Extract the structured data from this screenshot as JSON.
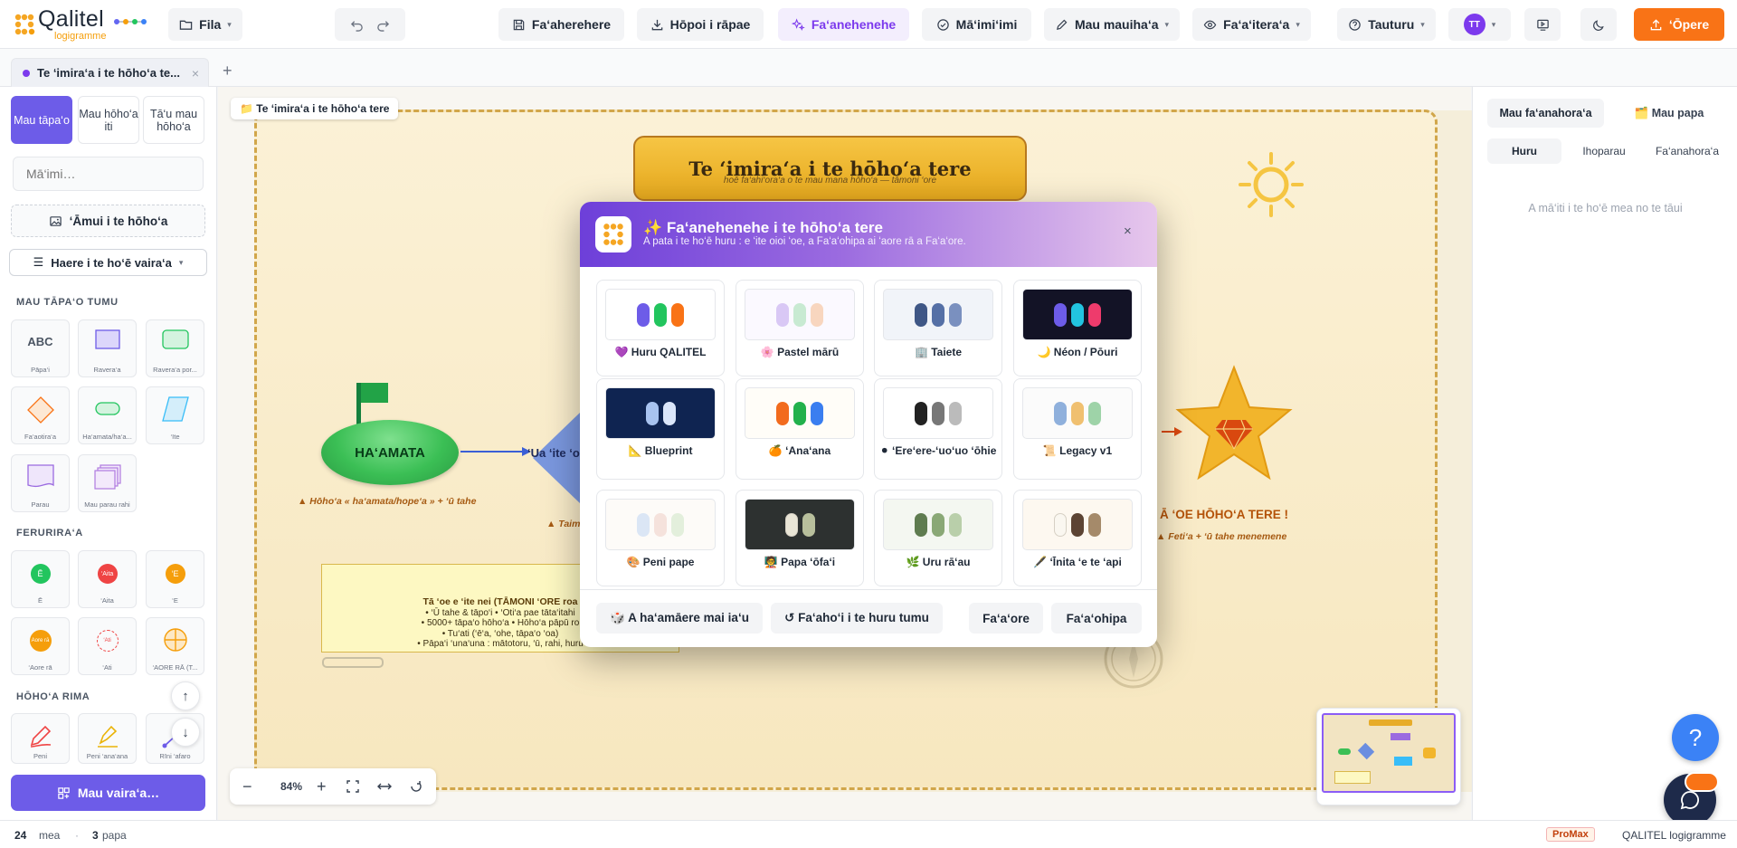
{
  "app": {
    "logo_name": "Qalitel",
    "logo_sub": "logigramme"
  },
  "toolbar": {
    "file": "Fila",
    "save": "Fa‘aherehere",
    "export": "Hōpoi i rāpae",
    "theme": "Fa‘anehenehe",
    "check": "Mā‘imi‘imi",
    "tools": "Mau mauiha‘a",
    "view": "Fa‘a‘itera‘a",
    "help": "Tauturu",
    "avatar": "TT",
    "publish": "‘Ōpere"
  },
  "tabs": [
    {
      "label": "Te ‘imira‘a i te hōho‘a te..."
    }
  ],
  "sidebar": {
    "tabs": [
      "Mau tāpa‘o",
      "Mau hōho‘a iti",
      "Tā‘u mau hōho‘a"
    ],
    "search_placeholder": "Mā‘imi…",
    "import_image": "‘Āmui i te hōho‘a",
    "mode": "Haere i te ho‘ē vaira‘a",
    "sections": [
      "MAU TĀPA‘O TUMU",
      "FERURIRA‘A",
      "HŌHO‘A RIMA"
    ],
    "shapes": [
      "Pāpa‘i",
      "Ravera‘a",
      "Ravera‘a por...",
      "Fa‘aotira‘a",
      "Ha‘amata/ha‘a...",
      "‘Ite",
      "Parau",
      "Mau parau rahi"
    ],
    "shape_abc": "ABC",
    "logic": [
      {
        "tag": "Ē",
        "label": "Ē"
      },
      {
        "tag": "‘Aita",
        "label": "‘Aita"
      },
      {
        "tag": "‘E",
        "label": "‘E"
      },
      {
        "tag": "Aore rā",
        "label": "‘Aore rā"
      },
      {
        "tag": "‘Ati",
        "label": "‘Ati"
      },
      {
        "tag": "",
        "label": "‘AORE RĀ (T..."
      }
    ],
    "draw": [
      "Peni",
      "Peni ‘ana‘ana",
      "Rīni ‘afaro"
    ],
    "templates_button": "Mau vaira‘a…"
  },
  "canvas": {
    "frame_label": "📁 Te ‘imira‘a i te hōho‘a tere",
    "title": "Te ‘imira‘a i te hōho‘a tere",
    "subtitle": "hoē fa‘ahi‘ora‘a o te mau mana hōho‘a — tāmoni ‘ore",
    "start": "HA‘AMATA",
    "start_note": "▲ Hōho‘a « ha‘amata/hope‘a » + ‘ū tahe",
    "decision": "‘Ua ‘ite ‘oe",
    "decision_note": "▲ Taim",
    "end": "Ā ‘OE HŌHO‘A TERE !",
    "end_note": "▲ Feti‘a + ‘ū tahe menemene",
    "note_title": "Tā ‘oe e ‘ite nei (TĀMONI ‘ORE roa",
    "note_lines": [
      "• ‘Ū tahe & tāpo‘i • ‘Oti‘a pae tāta‘itahi",
      "• 5000+ tāpa‘o hōho‘a • Hōho‘a pāpū ro",
      "• Tu‘ati (‘ē‘a, ‘ohe, tāpa‘o ‘oa)",
      "• Pāpa‘i ‘una‘una : mātotoru, ‘ū, rahi, huru"
    ],
    "zoom": "84%"
  },
  "modal": {
    "title": "✨ Fa‘anehenehe i te hōho‘a tere",
    "subtitle": "A pata i te ho‘ē huru : e ‘ite oioi ‘oe, a Fa‘a‘ohipa ai ‘aore rā a Fa‘a‘ore.",
    "themes": [
      {
        "name": "💜 Huru QALITEL",
        "bg": "#ffffff",
        "colors": [
          "#6d5ce8",
          "#22c55e",
          "#f97316"
        ]
      },
      {
        "name": "🌸 Pastel mārū",
        "bg": "#fbf9ff",
        "colors": [
          "#d9c8f5",
          "#c8ead2",
          "#f8d6bf"
        ]
      },
      {
        "name": "🏢 Taiete",
        "bg": "#f1f4f9",
        "colors": [
          "#3f5786",
          "#5570a6",
          "#7a90bf"
        ]
      },
      {
        "name": "🌙 Néon / Pōuri",
        "bg": "#131326",
        "colors": [
          "#6d5ce8",
          "#22c4e0",
          "#ee3b6c"
        ]
      },
      {
        "name": "📐 Blueprint",
        "bg": "#0f2451",
        "colors": [
          "#a8c3f0",
          "#dbe6fa"
        ]
      },
      {
        "name": "🍊 ‘Ana‘ana",
        "bg": "#fffdf8",
        "colors": [
          "#f26b1d",
          "#22b14c",
          "#3a7ef0"
        ]
      },
      {
        "name": "⚫ ‘Ere‘ere-‘uo‘uo ‘ōhie",
        "bg": "#ffffff",
        "colors": [
          "#222222",
          "#777777",
          "#bbbbbb"
        ]
      },
      {
        "name": "📜 Legacy v1",
        "bg": "#fbfbfb",
        "colors": [
          "#8fb0dc",
          "#f0c070",
          "#9ed3a8"
        ]
      },
      {
        "name": "🎨 Peni pape",
        "bg": "#fdfbf8",
        "colors": [
          "#dbe6f5",
          "#f5e2dc",
          "#e3efdc"
        ]
      },
      {
        "name": "🧑‍🏫 Papa ‘ōfa‘i",
        "bg": "#2d3130",
        "colors": [
          "#e9e5d6",
          "#b8bf9c"
        ]
      },
      {
        "name": "🌿 Uru rā‘au",
        "bg": "#f4f7f1",
        "colors": [
          "#5f7c50",
          "#8aa876",
          "#b9cfaa"
        ]
      },
      {
        "name": "🖋️ ‘Īnita ‘e te ‘api",
        "bg": "#fdf8f0",
        "colors": [
          "#faf7f0",
          "#5c4434",
          "#a58a6a"
        ]
      }
    ],
    "random": "🎲 A ha‘amāere mai ia‘u",
    "reset": "↺ Fa‘aho‘i i te huru tumu",
    "cancel": "Fa‘a‘ore",
    "apply": "Fa‘a‘ohipa"
  },
  "rpanel": {
    "tabs": [
      "Mau fa‘anahora‘a",
      "🗂️ Mau papa"
    ],
    "subtabs": [
      "Huru",
      "Ihoparau",
      "Fa‘anahora‘a"
    ],
    "empty": "A mā‘iti i te ho‘ē mea no te tāui"
  },
  "status": {
    "count": "24",
    "count_label": "mea",
    "pages": "3",
    "pages_label": "papa",
    "badge": "ProMax",
    "brand": "QALITEL logigramme"
  }
}
